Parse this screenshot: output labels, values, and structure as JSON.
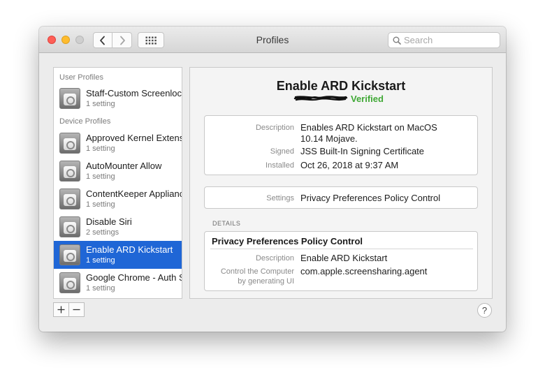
{
  "window": {
    "title": "Profiles",
    "traffic_lights": {
      "close": "#fe5f57",
      "minimize": "#febc2e",
      "zoom": "#cfcfcf"
    }
  },
  "toolbar": {
    "back_icon": "chevron-left-icon",
    "forward_icon": "chevron-right-icon",
    "grid_icon": "grid-icon"
  },
  "search": {
    "placeholder": "Search",
    "value": ""
  },
  "sidebar": {
    "user_header": "User Profiles",
    "device_header": "Device Profiles",
    "user_profiles": [
      {
        "name": "Staff-Custom Screenlock",
        "count": "1 setting"
      }
    ],
    "device_profiles": [
      {
        "name": "Approved Kernel Extensions",
        "count": "1 setting"
      },
      {
        "name": "AutoMounter Allow",
        "count": "1 setting"
      },
      {
        "name": "ContentKeeper Appliance",
        "count": "1 setting"
      },
      {
        "name": "Disable Siri",
        "count": "2 settings"
      },
      {
        "name": "Enable ARD Kickstart",
        "count": "1 setting",
        "selected": true
      },
      {
        "name": "Google Chrome - Auth Server",
        "count": "1 setting"
      }
    ],
    "selection_color": "#1f66d6"
  },
  "footer": {
    "add_label": "+",
    "remove_label": "−",
    "help_label": "?"
  },
  "detail": {
    "title": "Enable ARD Kickstart",
    "verified": "Verified",
    "verified_color": "#3fa835",
    "info": {
      "description_label": "Description",
      "description_line1": "Enables ARD Kickstart on MacOS",
      "description_line2": "10.14 Mojave.",
      "signed_label": "Signed",
      "signed_value": "JSS Built-In Signing Certificate",
      "installed_label": "Installed",
      "installed_value": "Oct 26, 2018 at 9:37 AM"
    },
    "settings": {
      "label": "Settings",
      "value": "Privacy Preferences Policy Control"
    },
    "details_caption": "DETAILS",
    "details": {
      "heading": "Privacy Preferences Policy Control",
      "description_label": "Description",
      "description_value": "Enable ARD Kickstart",
      "control_label_line1": "Control the Computer",
      "control_label_line2": "by generating UI",
      "control_value": "com.apple.screensharing.agent"
    }
  }
}
